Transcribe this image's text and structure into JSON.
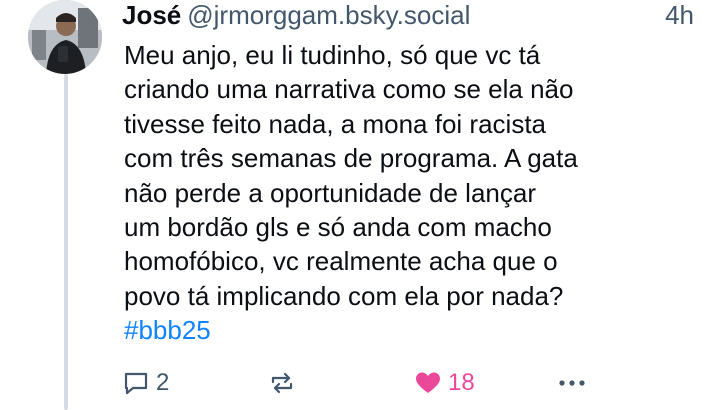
{
  "post": {
    "author": {
      "display_name": "José",
      "handle": "@jrmorggam.bsky.social"
    },
    "timestamp": "4h",
    "text_lines": [
      "Meu anjo, eu li tudinho, só que vc tá",
      "criando uma narrativa como se ela não",
      "tivesse feito nada, a mona foi racista",
      "com três semanas de programa. A gata",
      "não perde a oportunidade de lançar",
      "um bordão gls e só anda com macho",
      "homofóbico, vc realmente acha que o",
      "povo tá implicando com ela por nada?"
    ],
    "hashtag": "#bbb25",
    "actions": {
      "reply_count": "2",
      "like_count": "18"
    },
    "colors": {
      "accent": "#1083fe",
      "like": "#ec4899",
      "muted": "#42576c"
    },
    "icons": [
      "reply-icon",
      "repost-icon",
      "heart-icon",
      "more-icon"
    ]
  }
}
